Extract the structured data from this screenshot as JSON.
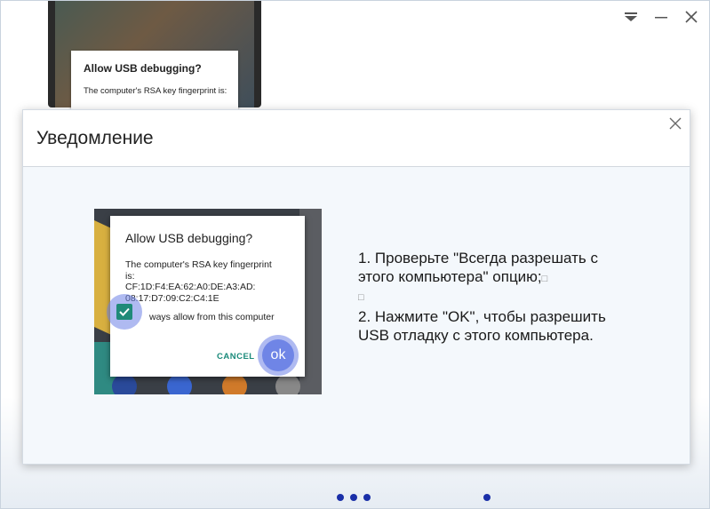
{
  "window": {
    "controls": [
      "dropdown-icon",
      "minimize-icon",
      "close-icon"
    ]
  },
  "background_dialog": {
    "title": "Allow USB debugging?",
    "body": "The computer's RSA key fingerprint is:"
  },
  "modal": {
    "title": "Уведомление",
    "close_icon": "close-icon"
  },
  "screenshot": {
    "dialog_title": "Allow USB debugging?",
    "body_line1": "The computer's RSA key fingerprint",
    "body_line2": "is:",
    "body_line3": "CF:1D:F4:EA:62:A0:DE:A3:AD:",
    "body_line4": "08:17:D7:09:C2:C4:1E",
    "checkbox_label": "ways allow from this computer",
    "cancel_label": "CANCEL",
    "ok_label": "ok"
  },
  "instructions": {
    "line1": "1. Проверьте \"Всегда разрешать с",
    "line2": "этого компьютера\" опцию;",
    "line2_box": "□",
    "line3_box": "□",
    "line4": "2. Нажмите \"OK\", чтобы разрешить",
    "line5": "USB отладку с этого компьютера."
  },
  "pagination": {
    "dots": 4,
    "accent": "#1a2fa8"
  },
  "colors": {
    "teal": "#1f8a78",
    "halo": "#6f85e6"
  }
}
